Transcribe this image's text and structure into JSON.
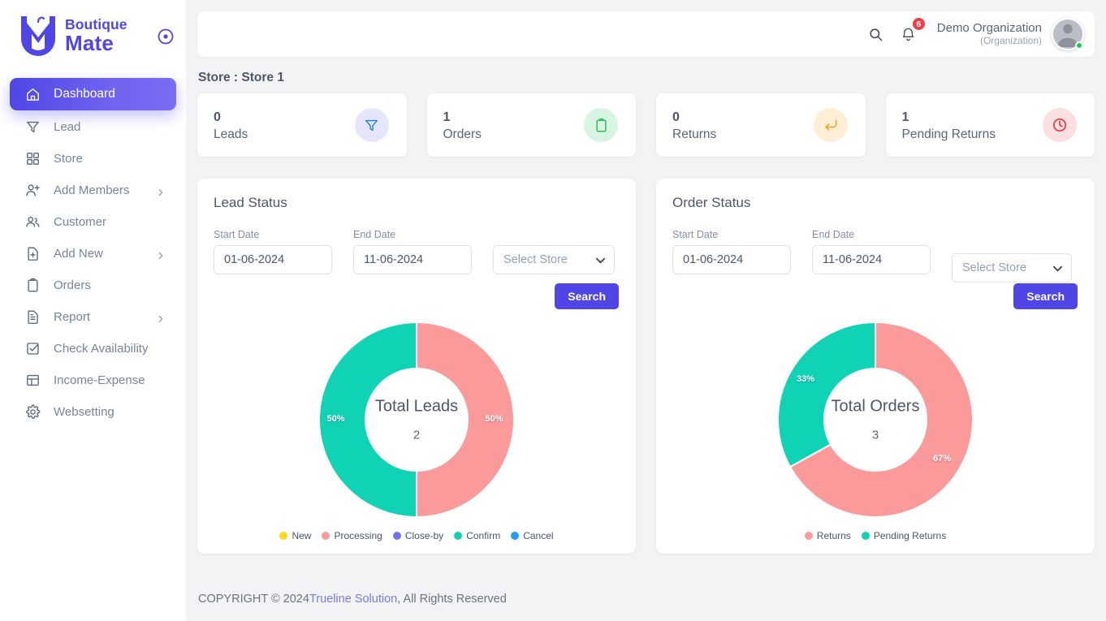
{
  "brand": {
    "line1": "Boutique",
    "line2": "Mate",
    "toggle_icon": "circle-dot-icon"
  },
  "sidebar": {
    "items": [
      {
        "label": "Dashboard",
        "icon": "home-icon",
        "active": true,
        "has_chevron": false
      },
      {
        "label": "Lead",
        "icon": "funnel-icon",
        "active": false,
        "has_chevron": false
      },
      {
        "label": "Store",
        "icon": "grid-icon",
        "active": false,
        "has_chevron": false
      },
      {
        "label": "Add Members",
        "icon": "user-plus-icon",
        "active": false,
        "has_chevron": true
      },
      {
        "label": "Customer",
        "icon": "users-icon",
        "active": false,
        "has_chevron": false
      },
      {
        "label": "Add New",
        "icon": "file-plus-icon",
        "active": false,
        "has_chevron": true
      },
      {
        "label": "Orders",
        "icon": "clipboard-icon",
        "active": false,
        "has_chevron": false
      },
      {
        "label": "Report",
        "icon": "document-icon",
        "active": false,
        "has_chevron": true
      },
      {
        "label": "Check Availability",
        "icon": "checkbox-icon",
        "active": false,
        "has_chevron": false
      },
      {
        "label": "Income-Expense",
        "icon": "layout-icon",
        "active": false,
        "has_chevron": false
      },
      {
        "label": "Websetting",
        "icon": "gear-icon",
        "active": false,
        "has_chevron": false
      }
    ]
  },
  "topbar": {
    "search_icon": "search-icon",
    "bell_icon": "bell-icon",
    "notification_count": "6",
    "org_name": "Demo Organization",
    "org_type": "(Organization)",
    "avatar_icon": "user-avatar"
  },
  "store_line": "Store : Store 1",
  "stats": [
    {
      "value": "0",
      "label": "Leads",
      "icon": "funnel-icon",
      "icon_color": "#1a7fe0",
      "bg_color": "#e6e6fb"
    },
    {
      "value": "1",
      "label": "Orders",
      "icon": "clipboard-icon",
      "icon_color": "#2bb356",
      "bg_color": "#d8f5e3"
    },
    {
      "value": "0",
      "label": "Returns",
      "icon": "return-arrow-icon",
      "icon_color": "#f0a431",
      "bg_color": "#fdeed5"
    },
    {
      "value": "1",
      "label": "Pending Returns",
      "icon": "clock-icon",
      "icon_color": "#e8343f",
      "bg_color": "#fbdfe1"
    }
  ],
  "lead_panel": {
    "title": "Lead Status",
    "start_label": "Start Date",
    "start_value": "01-06-2024",
    "end_label": "End Date",
    "end_value": "11-06-2024",
    "store_placeholder": "Select Store",
    "search_label": "Search"
  },
  "order_panel": {
    "title": "Order Status",
    "start_label": "Start Date",
    "start_value": "01-06-2024",
    "end_label": "End Date",
    "end_value": "11-06-2024",
    "store_placeholder": "Select Store",
    "search_label": "Search"
  },
  "footer": {
    "prefix": "COPYRIGHT © 2024 ",
    "link": "Trueline Solution",
    "suffix": ", All Rights Reserved"
  },
  "chart_data": [
    {
      "type": "pie",
      "title": "Total Leads",
      "center_value": "2",
      "donut": true,
      "legend_position": "bottom",
      "categories": [
        "New",
        "Processing",
        "Close-by",
        "Confirm",
        "Cancel"
      ],
      "colors": [
        "#ffd91c",
        "#fb9a9a",
        "#7a6ff0",
        "#0fd3b4",
        "#1f9ef1"
      ],
      "slices": [
        {
          "name": "Processing",
          "value": 1,
          "percent": 50,
          "color": "#fb9a9a",
          "label": "50%",
          "start_deg": 0,
          "end_deg": 180
        },
        {
          "name": "Confirm",
          "value": 1,
          "percent": 50,
          "color": "#0fd3b4",
          "label": "50%",
          "start_deg": 180,
          "end_deg": 360
        }
      ]
    },
    {
      "type": "pie",
      "title": "Total Orders",
      "center_value": "3",
      "donut": true,
      "legend_position": "bottom",
      "categories": [
        "Returns",
        "Pending Returns"
      ],
      "colors": [
        "#fb9a9a",
        "#0fd3b4"
      ],
      "slices": [
        {
          "name": "Returns",
          "value": 2,
          "percent": 67,
          "color": "#fb9a9a",
          "label": "67%",
          "start_deg": 0,
          "end_deg": 241
        },
        {
          "name": "Pending Returns",
          "value": 1,
          "percent": 33,
          "color": "#0fd3b4",
          "label": "33%",
          "start_deg": 241,
          "end_deg": 360
        }
      ]
    }
  ]
}
